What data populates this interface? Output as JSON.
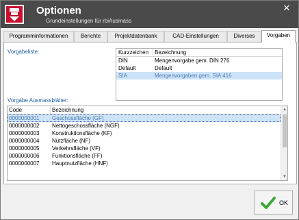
{
  "window": {
    "title": "Optionen",
    "subtitle": "Grundeinstellungen für rbiAusmass",
    "close_symbol": "✕"
  },
  "tabs": [
    {
      "label": "Programminformationen"
    },
    {
      "label": "Berichte"
    },
    {
      "label": "Projektdatenbank"
    },
    {
      "label": "CAD-Einstellungen"
    },
    {
      "label": "Diverses"
    },
    {
      "label": "Vorgaben",
      "active": true
    }
  ],
  "vorgabeliste": {
    "label": "Vorgabeliste:",
    "headers": [
      "Kurzzeichen",
      "Bezeichnung"
    ],
    "rows": [
      {
        "code": "DIN",
        "name": "Mengenvorgabe gem. DIN 276"
      },
      {
        "code": "Default",
        "name": "Default"
      },
      {
        "code": "SIA",
        "name": "Mengenvorgaben gem. SIA 416",
        "selected": true
      }
    ]
  },
  "ausmassblaetter": {
    "label": "Vorgabe Ausmassblätter:",
    "headers": [
      "Code",
      "Bezeichnung"
    ],
    "rows": [
      {
        "code": "0000000001",
        "name": "Geschossfläche (GF)",
        "selected": true
      },
      {
        "code": "0000000002",
        "name": "Nettogeschossfläche (NGF)"
      },
      {
        "code": "0000000003",
        "name": "Konstruktionsfläche (KF)"
      },
      {
        "code": "0000000004",
        "name": "Nutzfläche (NF)"
      },
      {
        "code": "0000000005",
        "name": "Verkehrsfläche (VF)"
      },
      {
        "code": "0000000006",
        "name": "Funktionsfläche (FF)"
      },
      {
        "code": "0000000007",
        "name": "Hauptnutzfläche (HNF)"
      }
    ]
  },
  "footer": {
    "ok_label": "OK"
  },
  "colors": {
    "titlebar": "#4a4a4a",
    "accent_label": "#1f5fa8",
    "selection": "#cde3f7",
    "ok_check": "#3aa832",
    "app_icon_red": "#c8102e"
  },
  "icons": {
    "app": "rbi-app-icon",
    "close": "close-icon",
    "ok": "checkmark-icon"
  }
}
